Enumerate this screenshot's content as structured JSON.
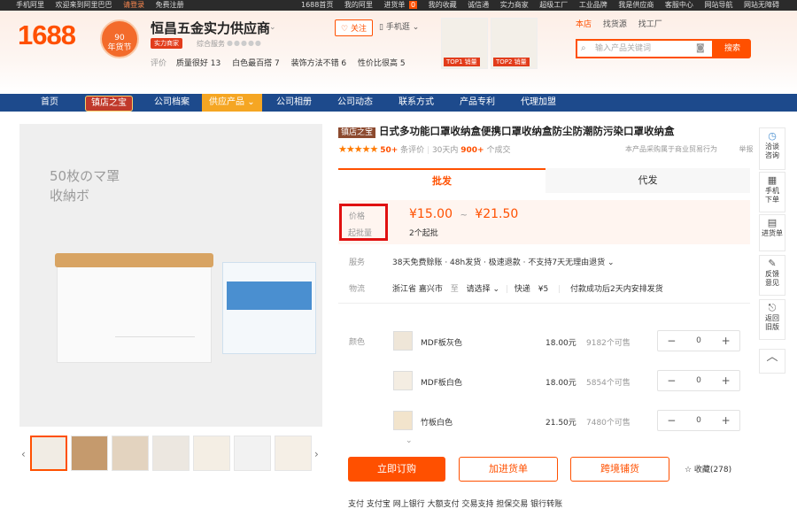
{
  "topbar": {
    "left": [
      "手机阿里",
      "欢迎来到阿里巴巴",
      "请登录",
      "免费注册"
    ],
    "right": [
      "1688首页",
      "我的阿里",
      "进货单",
      "0",
      "我的收藏",
      "诚信通",
      "实力商家",
      "超级工厂",
      "工业品牌",
      "我是供应商",
      "客服中心",
      "网站导航",
      "网站无障碍"
    ]
  },
  "header": {
    "logo": "1688",
    "badge": "90\n年货节",
    "shop_name": "恒昌五金实力供应商",
    "shop_tag": "实力商家",
    "service_label": "综合服务",
    "follow": "关注",
    "mobile_shop": "手机逛",
    "rating_label": "评价",
    "ratings": [
      "质量很好 13",
      "白色最百搭 7",
      "装饰方法不错 6",
      "性价比很高 5"
    ],
    "top1": "TOP1 销量",
    "top2": "TOP2 销量",
    "search_tabs": [
      "本店",
      "找货源",
      "找工厂"
    ],
    "search_placeholder": "输入产品关键词",
    "search_button": "搜索"
  },
  "nav": {
    "items": [
      "首页",
      "镇店之宝",
      "公司档案",
      "供应产品",
      "公司相册",
      "公司动态",
      "联系方式",
      "产品专利",
      "代理加盟"
    ]
  },
  "image": {
    "text_line1": "50枚のマ罩",
    "text_line2": "收納ボ"
  },
  "product": {
    "treasure_tag": "镇店之宝",
    "title": "日式多功能口罩收纳盒便携口罩收纳盒防尘防潮防污染口罩收纳盒",
    "stars": "★★★★★",
    "reviews": "50+",
    "reviews_suffix": "条评价",
    "sold_prefix": "30天内",
    "sold": "900+",
    "sold_suffix": "个成交",
    "note": "本产品采购属于商业贸易行为",
    "report": "举报"
  },
  "tabs": {
    "wholesale": "批发",
    "dropship": "代发"
  },
  "price": {
    "price_label": "价格",
    "moq_label": "起批量",
    "low": "¥15.00",
    "sep": "~",
    "high": "¥21.50",
    "moq": "2个起批"
  },
  "service": {
    "label": "服务",
    "value": "38天免费赊账 · 48h发货 · 极速退款 · 不支持7天无理由退货 ⌄"
  },
  "shipping": {
    "label": "物流",
    "from": "浙江省 嘉兴市",
    "to": "至",
    "choose": "请选择 ⌄",
    "carrier": "快递",
    "fee": "¥5",
    "note": "付款成功后2天内安排发货"
  },
  "variants": {
    "label": "颜色",
    "items": [
      {
        "name": "MDF板灰色",
        "price": "18.00元",
        "stock": "9182个可售",
        "qty": "0"
      },
      {
        "name": "MDF板白色",
        "price": "18.00元",
        "stock": "5854个可售",
        "qty": "0"
      },
      {
        "name": "竹板白色",
        "price": "21.50元",
        "stock": "7480个可售",
        "qty": "0"
      }
    ]
  },
  "actions": {
    "order": "立即订购",
    "cart": "加进货单",
    "dist": "跨境铺货",
    "fav": "☆ 收藏(278)"
  },
  "bottom": {
    "text": "支付    支付宝   网上银行   大额支付            交易支持   担保交易   银行转账"
  },
  "toolbar": [
    {
      "icon": "◷",
      "label": "洽谈咨询"
    },
    {
      "icon": "▦",
      "label": "手机下单"
    },
    {
      "icon": "▤",
      "label": "进货单"
    },
    {
      "icon": "✎",
      "label": "反馈意见"
    },
    {
      "icon": "⎋",
      "label": "返回旧版"
    },
    {
      "icon": "︿",
      "label": ""
    }
  ]
}
